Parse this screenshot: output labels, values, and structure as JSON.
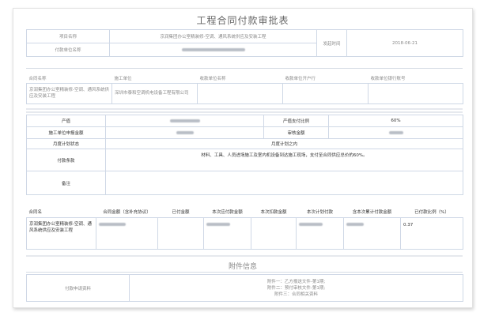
{
  "title": "工程合同付款审批表",
  "info": {
    "project_name_label": "项目名称",
    "project_name_value": "京润集团办公室精装修-空调、通风系统供应及安装工程",
    "payer_label": "付款单位名称",
    "date_label": "发起时间",
    "date_value": "2018-06-21"
  },
  "units_header": [
    "合同名称",
    "施工单位",
    "收款单位名称",
    "收款单位开户行",
    "收款单位银行账号"
  ],
  "units_row": {
    "contract": "京润集团办公室精装修-空调、通风系统供应及安装工程",
    "builder": "深圳市泰和空调机电设备工程有限公司"
  },
  "payment": {
    "output_label": "产值",
    "output_ratio_label": "产值支付比例",
    "output_ratio_value": "60%",
    "declared_label": "施工单位申报金额",
    "audit_label": "审核金额",
    "plan_status_label": "月度计划状态",
    "plan_status_value": "月度计划之内",
    "terms_label": "付款条款",
    "terms_value": "材料、工具、人员进场施工及室内机设备到达施工现场，支付至合同供应总价的60%。",
    "remark_label": "备注"
  },
  "contract_table": {
    "headers": [
      "合同名",
      "合同金额（含补充协议）",
      "已付金额",
      "本次应付款金额",
      "本次扣款金额",
      "本次计划付款",
      "含本次累计付款金额",
      "已付款比例（%）"
    ],
    "row": {
      "name": "京润集团办公室精装修-空调、通风系统供应及安装工程",
      "paid_ratio": "0.37"
    }
  },
  "attachments": {
    "title": "附件信息",
    "label": "付款申请资料",
    "items": [
      "附件一：乙方报送文件-第1期;",
      "附件二：预付审核文件-第1期;",
      "附件三：合同相关资料"
    ]
  }
}
